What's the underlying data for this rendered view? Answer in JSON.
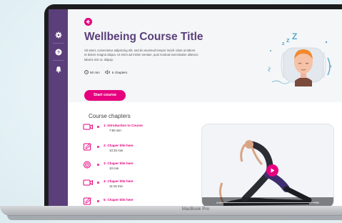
{
  "device": {
    "brand_label": "MacBook Pro"
  },
  "sidebar": {
    "icons": [
      "settings-icon",
      "help-icon",
      "notification-bell-icon"
    ]
  },
  "hero": {
    "title": "Wellbeing Course Title",
    "description": "Sit amet, consectetur adipiscing elit, sed do eiusmod tempor incidi- idunt ut labore et dolore magna aliqua. Ut enim ad minim veniam, quis nostrud exercitation ullamco laboris nisi ut. aliquip.",
    "duration": "50 min",
    "chapters_count": "6 chapters",
    "start_button": "Start course",
    "accent_color": "#e6007e",
    "brand_color": "#5b3f7a"
  },
  "chapters": {
    "heading": "Course chapters",
    "items": [
      {
        "title": "1: Introduction to Course",
        "duration": "7:50 min",
        "icon": "video-icon"
      },
      {
        "title": "2: Chaper title here",
        "duration": "10:10 min",
        "icon": "edit-icon"
      },
      {
        "title": "3: Chaper title here",
        "duration": "10 min",
        "icon": "target-icon"
      },
      {
        "title": "4: Chaper title here",
        "duration": "11:15 min",
        "icon": "video-icon"
      },
      {
        "title": "5: Chaper title here",
        "duration": "",
        "icon": "edit-icon"
      }
    ]
  },
  "video": {
    "time_current": "0:00",
    "time_total": "7:50"
  }
}
